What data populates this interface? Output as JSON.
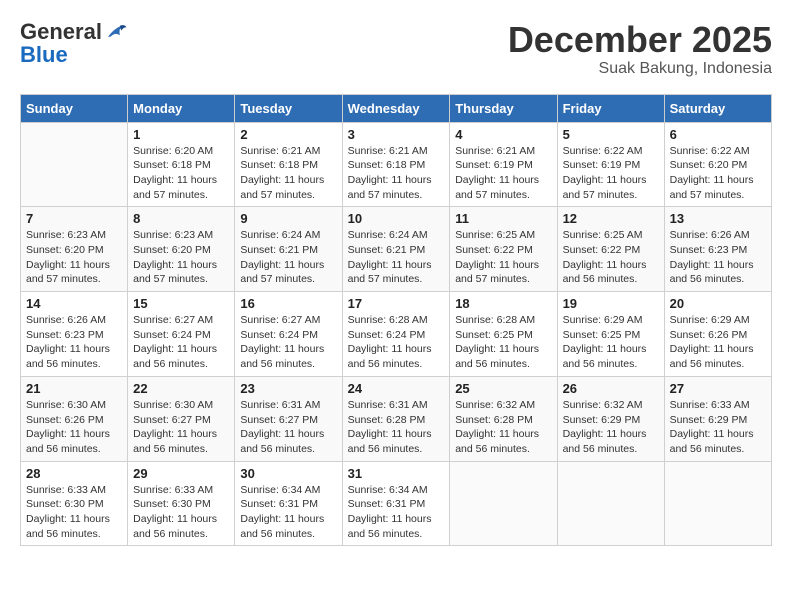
{
  "logo": {
    "text_general": "General",
    "text_blue": "Blue"
  },
  "title": {
    "month_year": "December 2025",
    "location": "Suak Bakung, Indonesia"
  },
  "weekdays": [
    "Sunday",
    "Monday",
    "Tuesday",
    "Wednesday",
    "Thursday",
    "Friday",
    "Saturday"
  ],
  "weeks": [
    [
      {
        "day": "",
        "sunrise": "",
        "sunset": "",
        "daylight": ""
      },
      {
        "day": "1",
        "sunrise": "Sunrise: 6:20 AM",
        "sunset": "Sunset: 6:18 PM",
        "daylight": "Daylight: 11 hours and 57 minutes."
      },
      {
        "day": "2",
        "sunrise": "Sunrise: 6:21 AM",
        "sunset": "Sunset: 6:18 PM",
        "daylight": "Daylight: 11 hours and 57 minutes."
      },
      {
        "day": "3",
        "sunrise": "Sunrise: 6:21 AM",
        "sunset": "Sunset: 6:18 PM",
        "daylight": "Daylight: 11 hours and 57 minutes."
      },
      {
        "day": "4",
        "sunrise": "Sunrise: 6:21 AM",
        "sunset": "Sunset: 6:19 PM",
        "daylight": "Daylight: 11 hours and 57 minutes."
      },
      {
        "day": "5",
        "sunrise": "Sunrise: 6:22 AM",
        "sunset": "Sunset: 6:19 PM",
        "daylight": "Daylight: 11 hours and 57 minutes."
      },
      {
        "day": "6",
        "sunrise": "Sunrise: 6:22 AM",
        "sunset": "Sunset: 6:20 PM",
        "daylight": "Daylight: 11 hours and 57 minutes."
      }
    ],
    [
      {
        "day": "7",
        "sunrise": "Sunrise: 6:23 AM",
        "sunset": "Sunset: 6:20 PM",
        "daylight": "Daylight: 11 hours and 57 minutes."
      },
      {
        "day": "8",
        "sunrise": "Sunrise: 6:23 AM",
        "sunset": "Sunset: 6:20 PM",
        "daylight": "Daylight: 11 hours and 57 minutes."
      },
      {
        "day": "9",
        "sunrise": "Sunrise: 6:24 AM",
        "sunset": "Sunset: 6:21 PM",
        "daylight": "Daylight: 11 hours and 57 minutes."
      },
      {
        "day": "10",
        "sunrise": "Sunrise: 6:24 AM",
        "sunset": "Sunset: 6:21 PM",
        "daylight": "Daylight: 11 hours and 57 minutes."
      },
      {
        "day": "11",
        "sunrise": "Sunrise: 6:25 AM",
        "sunset": "Sunset: 6:22 PM",
        "daylight": "Daylight: 11 hours and 57 minutes."
      },
      {
        "day": "12",
        "sunrise": "Sunrise: 6:25 AM",
        "sunset": "Sunset: 6:22 PM",
        "daylight": "Daylight: 11 hours and 56 minutes."
      },
      {
        "day": "13",
        "sunrise": "Sunrise: 6:26 AM",
        "sunset": "Sunset: 6:23 PM",
        "daylight": "Daylight: 11 hours and 56 minutes."
      }
    ],
    [
      {
        "day": "14",
        "sunrise": "Sunrise: 6:26 AM",
        "sunset": "Sunset: 6:23 PM",
        "daylight": "Daylight: 11 hours and 56 minutes."
      },
      {
        "day": "15",
        "sunrise": "Sunrise: 6:27 AM",
        "sunset": "Sunset: 6:24 PM",
        "daylight": "Daylight: 11 hours and 56 minutes."
      },
      {
        "day": "16",
        "sunrise": "Sunrise: 6:27 AM",
        "sunset": "Sunset: 6:24 PM",
        "daylight": "Daylight: 11 hours and 56 minutes."
      },
      {
        "day": "17",
        "sunrise": "Sunrise: 6:28 AM",
        "sunset": "Sunset: 6:24 PM",
        "daylight": "Daylight: 11 hours and 56 minutes."
      },
      {
        "day": "18",
        "sunrise": "Sunrise: 6:28 AM",
        "sunset": "Sunset: 6:25 PM",
        "daylight": "Daylight: 11 hours and 56 minutes."
      },
      {
        "day": "19",
        "sunrise": "Sunrise: 6:29 AM",
        "sunset": "Sunset: 6:25 PM",
        "daylight": "Daylight: 11 hours and 56 minutes."
      },
      {
        "day": "20",
        "sunrise": "Sunrise: 6:29 AM",
        "sunset": "Sunset: 6:26 PM",
        "daylight": "Daylight: 11 hours and 56 minutes."
      }
    ],
    [
      {
        "day": "21",
        "sunrise": "Sunrise: 6:30 AM",
        "sunset": "Sunset: 6:26 PM",
        "daylight": "Daylight: 11 hours and 56 minutes."
      },
      {
        "day": "22",
        "sunrise": "Sunrise: 6:30 AM",
        "sunset": "Sunset: 6:27 PM",
        "daylight": "Daylight: 11 hours and 56 minutes."
      },
      {
        "day": "23",
        "sunrise": "Sunrise: 6:31 AM",
        "sunset": "Sunset: 6:27 PM",
        "daylight": "Daylight: 11 hours and 56 minutes."
      },
      {
        "day": "24",
        "sunrise": "Sunrise: 6:31 AM",
        "sunset": "Sunset: 6:28 PM",
        "daylight": "Daylight: 11 hours and 56 minutes."
      },
      {
        "day": "25",
        "sunrise": "Sunrise: 6:32 AM",
        "sunset": "Sunset: 6:28 PM",
        "daylight": "Daylight: 11 hours and 56 minutes."
      },
      {
        "day": "26",
        "sunrise": "Sunrise: 6:32 AM",
        "sunset": "Sunset: 6:29 PM",
        "daylight": "Daylight: 11 hours and 56 minutes."
      },
      {
        "day": "27",
        "sunrise": "Sunrise: 6:33 AM",
        "sunset": "Sunset: 6:29 PM",
        "daylight": "Daylight: 11 hours and 56 minutes."
      }
    ],
    [
      {
        "day": "28",
        "sunrise": "Sunrise: 6:33 AM",
        "sunset": "Sunset: 6:30 PM",
        "daylight": "Daylight: 11 hours and 56 minutes."
      },
      {
        "day": "29",
        "sunrise": "Sunrise: 6:33 AM",
        "sunset": "Sunset: 6:30 PM",
        "daylight": "Daylight: 11 hours and 56 minutes."
      },
      {
        "day": "30",
        "sunrise": "Sunrise: 6:34 AM",
        "sunset": "Sunset: 6:31 PM",
        "daylight": "Daylight: 11 hours and 56 minutes."
      },
      {
        "day": "31",
        "sunrise": "Sunrise: 6:34 AM",
        "sunset": "Sunset: 6:31 PM",
        "daylight": "Daylight: 11 hours and 56 minutes."
      },
      {
        "day": "",
        "sunrise": "",
        "sunset": "",
        "daylight": ""
      },
      {
        "day": "",
        "sunrise": "",
        "sunset": "",
        "daylight": ""
      },
      {
        "day": "",
        "sunrise": "",
        "sunset": "",
        "daylight": ""
      }
    ]
  ]
}
